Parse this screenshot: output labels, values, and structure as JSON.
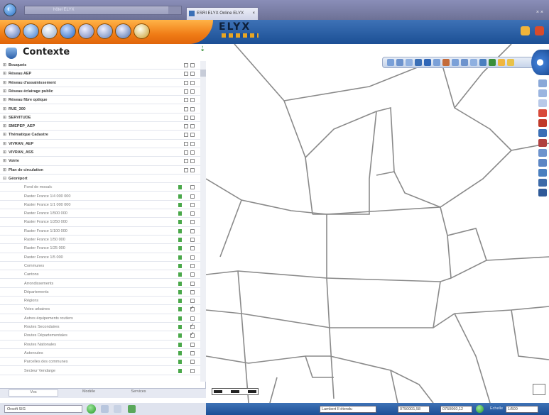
{
  "browser": {
    "address": "hôtel ELYX",
    "tab_title": "ESRI ELYX Online ELYX",
    "tab_close": "×",
    "window_controls": "× ×",
    "back_icon": "back-arrow-icon"
  },
  "app": {
    "logo": "ELYX",
    "colors": {
      "toolbar_orange": "#f07c16",
      "toolbar_blue": "#1c4f95"
    }
  },
  "panel": {
    "title": "Contexte",
    "groups": [
      "Bouquets",
      "Réseau AEP",
      "Réseau d'assainissement",
      "Réseau éclairage public",
      "Réseau fibre optique",
      "RUE_300",
      "SERVITUDE",
      "SMEPEP_AEP",
      "Thématique Cadastre",
      "VIVRAN_AEP",
      "VIVRAN_ASS",
      "Voirie",
      "Plan de circulation",
      "Géoréport"
    ],
    "sublayers": [
      {
        "label": "Fond de mosaïc",
        "checked": false
      },
      {
        "label": "Raster France 1/4 000 000",
        "checked": false
      },
      {
        "label": "Raster France 1/1 000 000",
        "checked": false
      },
      {
        "label": "Raster France 1/500 000",
        "checked": false
      },
      {
        "label": "Raster France 1/250 000",
        "checked": false
      },
      {
        "label": "Raster France 1/100 000",
        "checked": false
      },
      {
        "label": "Raster France 1/50 000",
        "checked": false
      },
      {
        "label": "Raster France 1/25 000",
        "checked": false
      },
      {
        "label": "Raster France 1/5 000",
        "checked": false
      },
      {
        "label": "Communes",
        "checked": false
      },
      {
        "label": "Cantons",
        "checked": false
      },
      {
        "label": "Arrondissements",
        "checked": false
      },
      {
        "label": "Départements",
        "checked": false
      },
      {
        "label": "Régions",
        "checked": false
      },
      {
        "label": "Voies urbaines",
        "checked": true
      },
      {
        "label": "Autres équipements routiers",
        "checked": false
      },
      {
        "label": "Routes Secondaires",
        "checked": true
      },
      {
        "label": "Routes Départementales",
        "checked": true
      },
      {
        "label": "Routes Nationales",
        "checked": false
      },
      {
        "label": "Autoroutes",
        "checked": false
      },
      {
        "label": "Parcelles des communes",
        "checked": false
      },
      {
        "label": "Secteur Vendarge",
        "checked": false
      }
    ],
    "tabs": [
      "Vos",
      "Modèle",
      "Services"
    ]
  },
  "status": {
    "selector": "Orsoft SIG",
    "projection": "Lambert II étendu",
    "x_value": "0750001,58",
    "y_value": "0750060,12",
    "scale_label": "Echelle",
    "scale_value": "1/500"
  }
}
